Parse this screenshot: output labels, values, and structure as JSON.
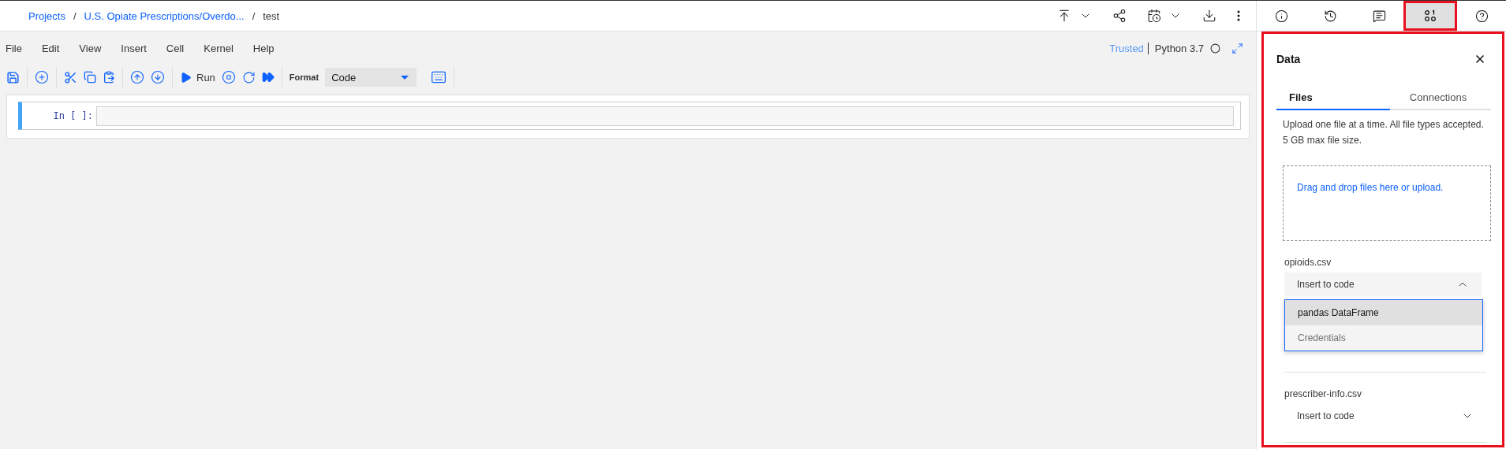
{
  "breadcrumb": [
    {
      "kind": "link",
      "label": "Projects"
    },
    {
      "kind": "separator",
      "label": "/"
    },
    {
      "kind": "link",
      "label": "U.S. Opiate Prescriptions/Overdo..."
    },
    {
      "kind": "separator",
      "label": "/"
    },
    {
      "kind": "current",
      "label": "test"
    }
  ],
  "top_tools": [
    {
      "kind": "publish",
      "menu": true
    },
    {
      "kind": "share",
      "menu": false
    },
    {
      "kind": "schedule",
      "menu": true
    },
    {
      "kind": "download",
      "menu": false
    },
    {
      "kind": "more",
      "menu": false
    }
  ],
  "side_tabs": [
    {
      "kind": "info",
      "selected": false
    },
    {
      "kind": "history",
      "selected": false
    },
    {
      "kind": "comments",
      "selected": false
    },
    {
      "kind": "data",
      "selected": true
    },
    {
      "kind": "help",
      "selected": false
    }
  ],
  "menu": [
    "File",
    "Edit",
    "View",
    "Insert",
    "Cell",
    "Kernel",
    "Help"
  ],
  "kernel": {
    "trusted": "Trusted",
    "name": "Python 3.7"
  },
  "toolbar": {
    "run": "Run",
    "format_label": "Format",
    "format_value": "Code"
  },
  "cell": {
    "prompt": "In [ ]:"
  },
  "panel": {
    "title": "Data",
    "tabs": [
      {
        "label": "Files",
        "selected": true
      },
      {
        "label": "Connections",
        "selected": false
      }
    ],
    "description": "Upload one file at a time. All file types accepted. 5 GB max file size.",
    "dropzone": "Drag and drop files here or upload.",
    "files": [
      {
        "name": "opioids.csv",
        "action": "Insert to code",
        "expanded": true,
        "options": [
          {
            "label": "pandas DataFrame",
            "highlighted": true
          },
          {
            "label": "Credentials",
            "highlighted": false
          }
        ]
      },
      {
        "name": "prescriber-info.csv",
        "action": "Insert to code",
        "expanded": false
      }
    ]
  }
}
